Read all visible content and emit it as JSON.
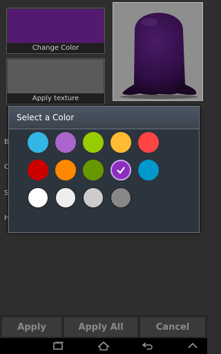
{
  "tiles": {
    "color_caption": "Change Color",
    "texture_caption": "Apply texture",
    "current_color": "#531b6f"
  },
  "background_rows": [
    "B",
    "C",
    "S",
    "H"
  ],
  "dialog": {
    "title": "Select a Color",
    "selected_color": "#8c2fbe",
    "colors": [
      "#33b5e5",
      "#aa66cc",
      "#99cc00",
      "#ffbb33",
      "#ff4444",
      "#cc0000",
      "#ff8800",
      "#669900",
      "#8c2fbe",
      "#0099cc",
      "#ffffff",
      "#eeeeee",
      "#cccccc",
      "#888888"
    ]
  },
  "buttons": {
    "apply": "Apply",
    "apply_all": "Apply All",
    "cancel": "Cancel"
  },
  "navbar": {
    "icons": [
      "recent-apps-icon",
      "home-icon",
      "back-icon",
      "up-icon"
    ]
  }
}
